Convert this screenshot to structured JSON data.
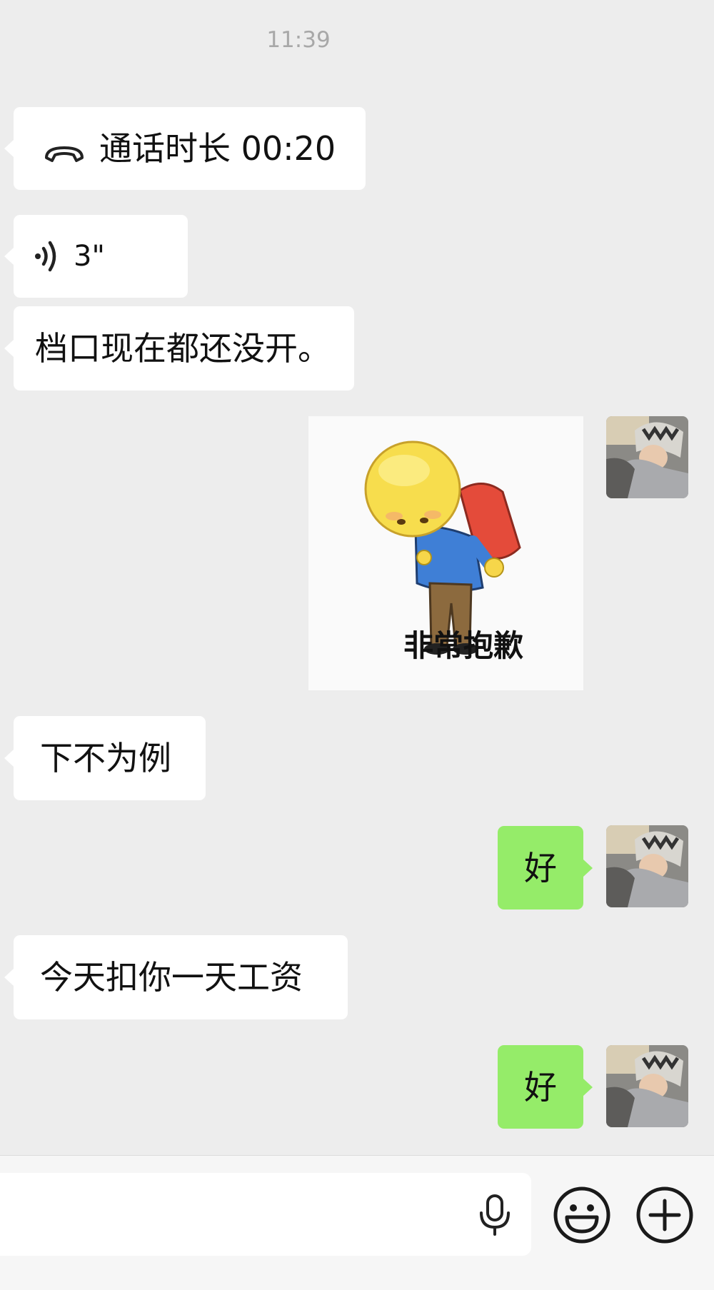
{
  "timestamp": "11:39",
  "messages": [
    {
      "side": "left",
      "type": "call",
      "icon": "phone-hangup-icon",
      "text": "通话时长 00:20"
    },
    {
      "side": "left",
      "type": "voice",
      "icon": "voice-wave-icon",
      "text": "3\""
    },
    {
      "side": "left",
      "type": "text",
      "text": "档口现在都还没开。"
    },
    {
      "side": "right",
      "type": "sticker",
      "sticker_caption": "非常抱歉"
    },
    {
      "side": "left",
      "type": "text",
      "text": "下不为例"
    },
    {
      "side": "right",
      "type": "text",
      "text": "好"
    },
    {
      "side": "left",
      "type": "text",
      "text": "今天扣你一天工资"
    },
    {
      "side": "right",
      "type": "text",
      "text": "好"
    }
  ],
  "input_bar": {
    "mic_icon": "microphone-icon",
    "emoji_icon": "smiley-icon",
    "plus_icon": "plus-circle-icon"
  },
  "colors": {
    "background": "#ededed",
    "sent_bubble": "#95ec69",
    "received_bubble": "#ffffff"
  }
}
